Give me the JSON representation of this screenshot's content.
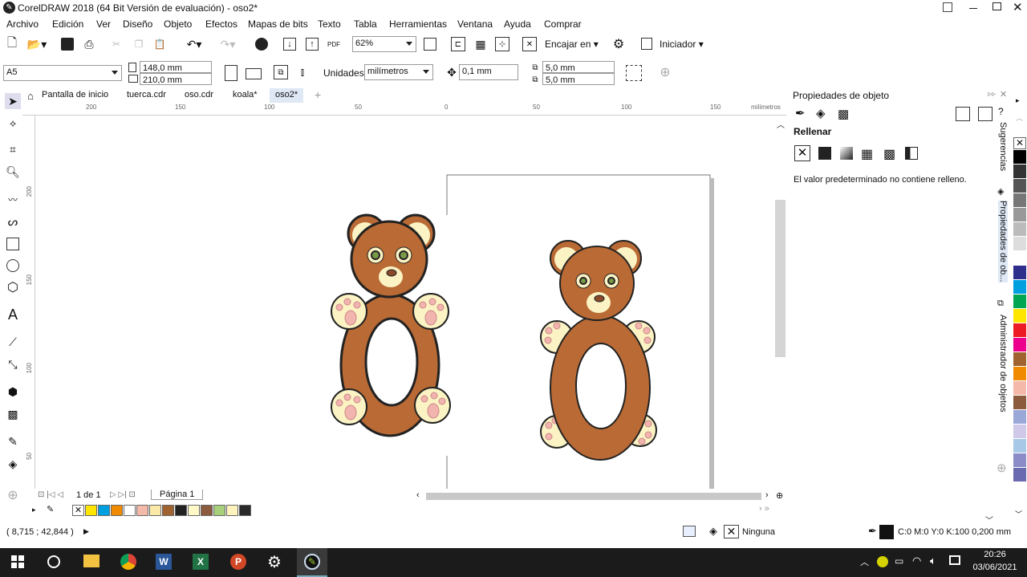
{
  "window": {
    "title": "CorelDRAW 2018 (64 Bit Versión de evaluación) - oso2*"
  },
  "menu": [
    "Archivo",
    "Edición",
    "Ver",
    "Diseño",
    "Objeto",
    "Efectos",
    "Mapas de bits",
    "Texto",
    "Tabla",
    "Herramientas",
    "Ventana",
    "Ayuda",
    "Comprar"
  ],
  "toolbar": {
    "zoom": "62%",
    "fit_label": "Encajar en",
    "launcher_label": "Iniciador"
  },
  "propbar": {
    "page_size": "A5",
    "width": "148,0 mm",
    "height": "210,0 mm",
    "units_label": "Unidades:",
    "units": "milímetros",
    "nudge": "0,1 mm",
    "dup_x": "5,0 mm",
    "dup_y": "5,0 mm"
  },
  "tabs": [
    "Pantalla de inicio",
    "tuerca.cdr",
    "oso.cdr",
    "koala*",
    "oso2*"
  ],
  "ruler": {
    "ticks": [
      "200",
      "150",
      "100",
      "50",
      "0",
      "50",
      "100",
      "150"
    ],
    "unit": "milímetros",
    "vticks": [
      "200",
      "150",
      "100",
      "50"
    ]
  },
  "pagebar": {
    "page_count": "1 de 1",
    "page_name": "Página 1"
  },
  "panel": {
    "title": "Propiedades de objeto",
    "fill_heading": "Rellenar",
    "fill_desc": "El valor predeterminado no contiene relleno."
  },
  "dock": {
    "hints": "Sugerencias",
    "props": "Propiedades de ob...",
    "objects": "Administrador de objetos"
  },
  "status": {
    "coords": "( 8,715 ; 42,844 )",
    "fill": "Ninguna",
    "outline": "C:0 M:0 Y:0 K:100  0,200 mm"
  },
  "clock": {
    "time": "20:26",
    "date": "03/06/2021"
  },
  "colors": {
    "bear_body": "#b96a35",
    "bear_ear": "#fbf3c4",
    "paw": "#fbf3c4",
    "pad": "#f2b4ae"
  },
  "palette_colors": [
    "#ffe600",
    "#00a0e0",
    "#f08a00",
    "#ffffff",
    "#f4b9a8",
    "#fbe9a8",
    "#a0622f",
    "#222222",
    "#fff9c8",
    "#8c5a3c",
    "#a8d07a",
    "#fff3bd",
    "#2a2a2a"
  ],
  "side_palette": [
    "#000000",
    "#333333",
    "#555555",
    "#777777",
    "#999999",
    "#bbbbbb",
    "#dddddd",
    "#ffffff",
    "#2e2e8c",
    "#00a0e0",
    "#00a651",
    "#ffe600",
    "#ed1c24",
    "#ec008c",
    "#a0622f",
    "#f08a00",
    "#f4b9a8",
    "#8c5a3c",
    "#9aa8d8",
    "#d0c8e8",
    "#a8c8e8",
    "#8c8cc8",
    "#6a6ab0"
  ]
}
